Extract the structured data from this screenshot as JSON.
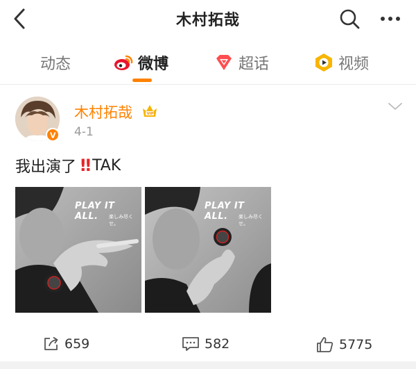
{
  "header": {
    "title": "木村拓哉",
    "back_icon": "chevron-left-icon",
    "search_icon": "search-icon",
    "more_icon": "more-dots-icon"
  },
  "tabs": [
    {
      "label": "动态",
      "icon": null,
      "active": false
    },
    {
      "label": "微博",
      "icon": "weibo-icon",
      "active": true
    },
    {
      "label": "超话",
      "icon": "super-topic-icon",
      "active": false
    },
    {
      "label": "视频",
      "icon": "video-icon",
      "active": false
    }
  ],
  "post": {
    "author": "木村拓哉",
    "date": "4-1",
    "text": "我出演了",
    "emoji": "‼",
    "signature": "TAK",
    "images": [
      {
        "headline": "PLAY IT ALL.",
        "sub": "楽しみ尽くせ。"
      },
      {
        "headline": "PLAY IT ALL.",
        "sub": "楽しみ尽くせ。"
      }
    ]
  },
  "actions": {
    "share_count": "659",
    "comment_count": "582",
    "like_count": "5775"
  },
  "colors": {
    "accent": "#ff8200",
    "author_name": "#ff8200",
    "emoji_red": "#e4272b",
    "muted": "#999999"
  }
}
